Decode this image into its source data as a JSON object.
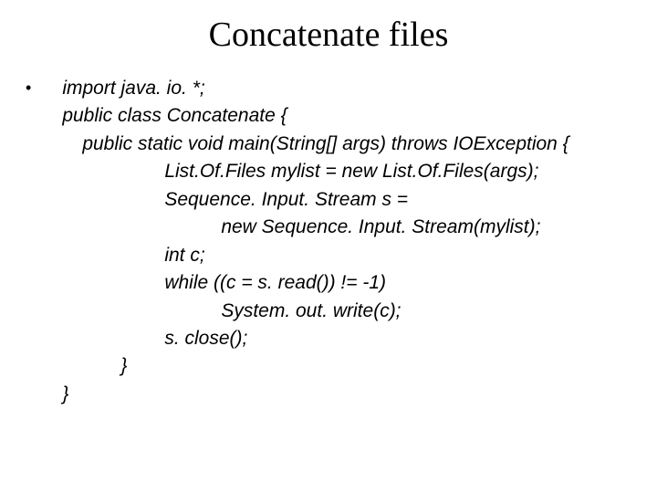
{
  "title": "Concatenate files",
  "bullet": "•",
  "code": {
    "l0": "import java. io. *;",
    "l1": "public class Concatenate {",
    "l2": "public static void main(String[] args) throws IOException {",
    "l3": "List.Of.Files mylist = new List.Of.Files(args);",
    "l4": "Sequence. Input. Stream s =",
    "l5": "new Sequence. Input. Stream(mylist);",
    "l6": "int c;",
    "l7": "while ((c = s. read()) != -1)",
    "l8": "System. out. write(c);",
    "l9": "s. close();",
    "l10": "}",
    "l11": "}"
  }
}
